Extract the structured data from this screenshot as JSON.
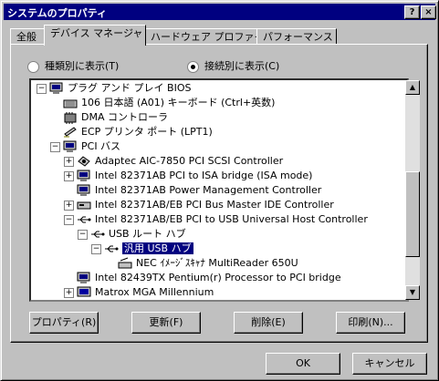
{
  "window": {
    "title": "システムのプロパティ",
    "help_btn": "?",
    "close_btn": "×"
  },
  "tabs": [
    "全般",
    "デバイス マネージャ",
    "ハードウェア プロファイル",
    "パフォーマンス"
  ],
  "radio": {
    "by_type": "種類別に表示(T)",
    "by_connection": "接続別に表示(C)"
  },
  "tree": [
    {
      "label": "プラグ アンド プレイ BIOS",
      "icon": "computer-icon",
      "expander": "−"
    },
    {
      "label": "106 日本語 (A01) キーボード (Ctrl+英数)",
      "icon": "keyboard-icon",
      "expander": ""
    },
    {
      "label": "DMA コントローラ",
      "icon": "device-icon",
      "expander": ""
    },
    {
      "label": "ECP プリンタ ポート (LPT1)",
      "icon": "printer-port-icon",
      "expander": ""
    },
    {
      "label": "PCI バス",
      "icon": "computer-icon",
      "expander": "−"
    },
    {
      "label": "Adaptec AIC-7850 PCI SCSI Controller",
      "icon": "scsi-icon",
      "expander": "+"
    },
    {
      "label": "Intel 82371AB PCI to ISA bridge (ISA mode)",
      "icon": "computer-icon",
      "expander": "+"
    },
    {
      "label": "Intel 82371AB Power Management Controller",
      "icon": "computer-icon",
      "expander": ""
    },
    {
      "label": "Intel 82371AB/EB PCI Bus Master IDE Controller",
      "icon": "disk-controller-icon",
      "expander": "+"
    },
    {
      "label": "Intel 82371AB/EB PCI to USB Universal Host Controller",
      "icon": "usb-icon",
      "expander": "−"
    },
    {
      "label": "USB ルート ハブ",
      "icon": "usb-icon",
      "expander": "−"
    },
    {
      "label": "汎用 USB ハブ",
      "icon": "usb-icon",
      "expander": "−",
      "selected": true
    },
    {
      "label": "NEC ｲﾒｰｼﾞｽｷｬﾅ MultiReader 650U",
      "icon": "scanner-icon",
      "expander": ""
    },
    {
      "label": "Intel 82439TX Pentium(r) Processor to PCI bridge",
      "icon": "computer-icon",
      "expander": ""
    },
    {
      "label": "Matrox MGA Millennium",
      "icon": "display-icon",
      "expander": "+"
    }
  ],
  "buttons": {
    "properties": "プロパティ(R)",
    "refresh": "更新(F)",
    "remove": "削除(E)",
    "print": "印刷(N)..."
  },
  "dialog": {
    "ok": "OK",
    "cancel": "キャンセル"
  }
}
